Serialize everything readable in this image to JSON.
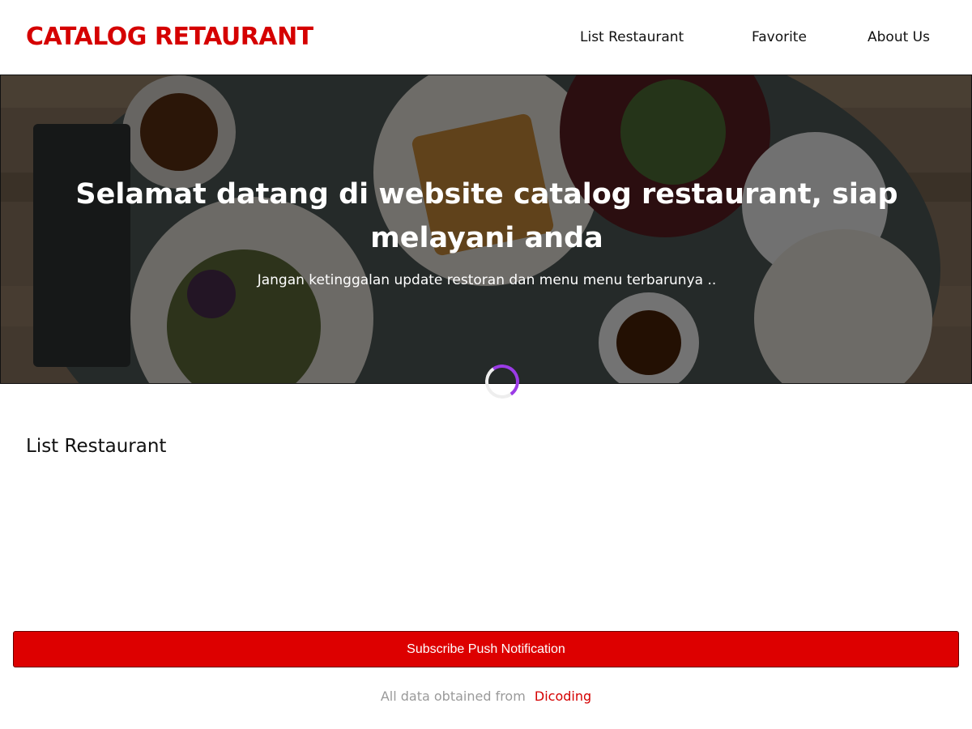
{
  "header": {
    "brand": "CATALOG RETAURANT",
    "nav": {
      "list_restaurant": "List Restaurant",
      "favorite": "Favorite",
      "about_us": "About Us"
    }
  },
  "hero": {
    "title": "Selamat datang di website catalog restaurant, siap melayani anda",
    "subtitle": "Jangan ketinggalan update restoran dan menu menu terbarunya .."
  },
  "main": {
    "section_title": "List Restaurant",
    "restaurants": []
  },
  "push": {
    "subscribe_label": "Subscribe Push Notification"
  },
  "footer": {
    "text": "All data obtained from",
    "link_label": "Dicoding"
  },
  "colors": {
    "brand": "#d50000",
    "button": "#dd0000",
    "spinner": "#9b3be6",
    "footer_text": "#9a9a9a"
  },
  "icons": {
    "loader": "loading-spinner-icon"
  }
}
